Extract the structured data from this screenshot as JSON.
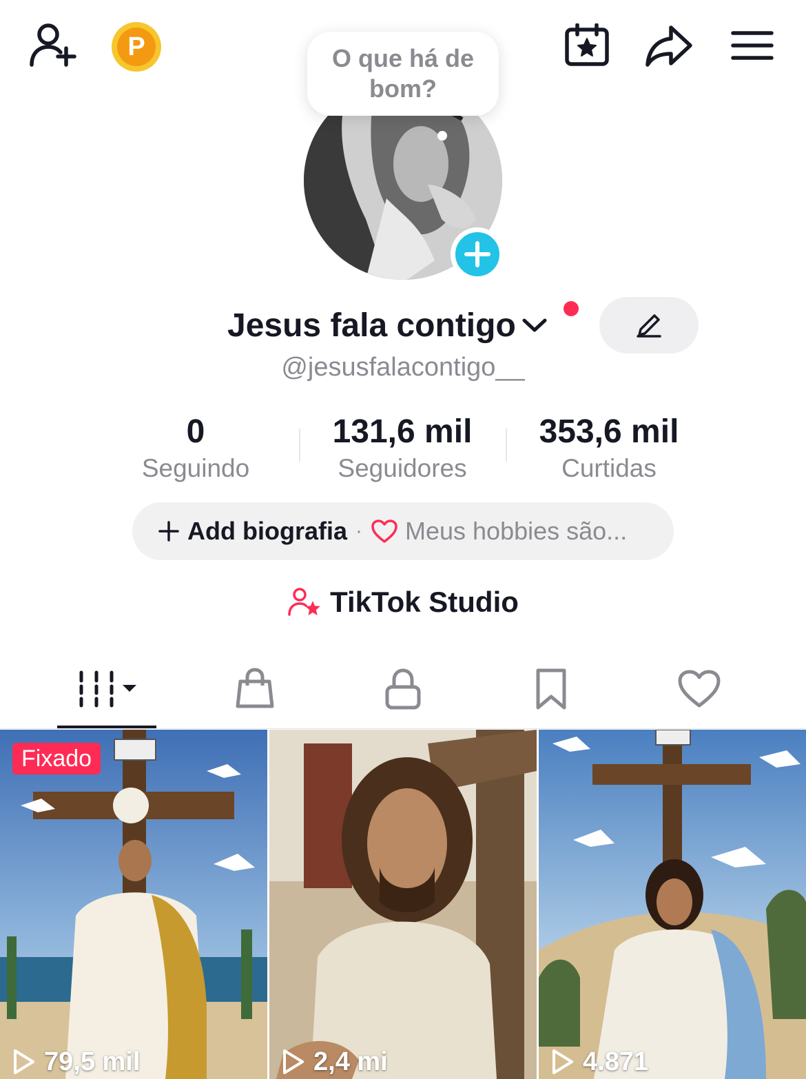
{
  "header": {
    "add_friend_icon": "add-user-icon",
    "coin_letter": "P",
    "calendar_icon": "calendar-star-icon",
    "share_icon": "share-arrow-icon",
    "menu_icon": "hamburger-icon"
  },
  "note_bubble": {
    "text": "O que há de bom?"
  },
  "profile": {
    "display_name": "Jesus fala contigo",
    "username": "@jesusfalacontigo__",
    "notification_color": "#fe2c55"
  },
  "stats": [
    {
      "value": "0",
      "label": "Seguindo"
    },
    {
      "value": "131,6 mil",
      "label": "Seguidores"
    },
    {
      "value": "353,6 mil",
      "label": "Curtidas"
    }
  ],
  "bio": {
    "add_label": "Add biografia",
    "separator": "·",
    "hobby_placeholder": "Meus hobbies são..."
  },
  "studio": {
    "label": "TikTok Studio",
    "accent": "#fe2c55"
  },
  "tabs": [
    {
      "icon": "videos-grid-icon",
      "active": true
    },
    {
      "icon": "shopping-bag-icon",
      "active": false
    },
    {
      "icon": "lock-icon",
      "active": false
    },
    {
      "icon": "bookmark-icon",
      "active": false
    },
    {
      "icon": "heart-icon",
      "active": false
    }
  ],
  "videos": [
    {
      "badge": "Fixado",
      "views": "79,5 mil"
    },
    {
      "views": "2,4 mi"
    },
    {
      "views": "4.871"
    }
  ],
  "colors": {
    "accent_blue": "#22c3e6",
    "pill_bg": "#f1f1f2",
    "muted_text": "#8a8b91"
  }
}
